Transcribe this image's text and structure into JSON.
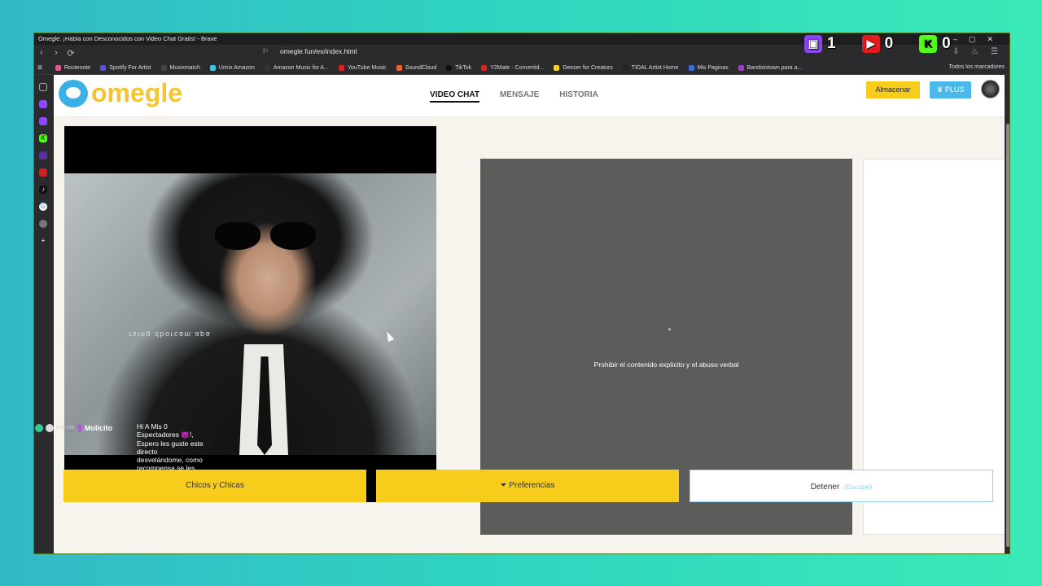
{
  "window": {
    "title": "Omegle: ¡Habla con Desconocidos con Video Chat Gratis! - Brave",
    "url": "omegle.fun/es/index.html"
  },
  "bookmarks": [
    {
      "label": "Routenote",
      "color": "#e05a8c"
    },
    {
      "label": "Spotify For Artist",
      "color": "#5b4fd8"
    },
    {
      "label": "Musixmatch",
      "color": "#444"
    },
    {
      "label": "Urtrix Amazon",
      "color": "#46c4e6"
    },
    {
      "label": "Amazon Music for A...",
      "color": "#333"
    },
    {
      "label": "YouTube Music",
      "color": "#e21f1f"
    },
    {
      "label": "SoundCloud",
      "color": "#ff5a1f"
    },
    {
      "label": "TikTok",
      "color": "#111"
    },
    {
      "label": "Y2Mate - Convertid...",
      "color": "#d22"
    },
    {
      "label": "Deezer for Creators",
      "color": "#f4d329"
    },
    {
      "label": "TIDAL Artist Home",
      "color": "#222"
    },
    {
      "label": "Mis Paginas",
      "color": "#3a6cd8"
    },
    {
      "label": "Bandsintown para a...",
      "color": "#a33ac8"
    }
  ],
  "bookmarks_all": "Todos los marcadores",
  "counters": [
    {
      "icon": "twitch-icon",
      "value": "1",
      "color": "#8a43f2"
    },
    {
      "icon": "youtube-icon",
      "value": "0",
      "color": "#e41b1b"
    },
    {
      "icon": "kick-icon",
      "value": "0",
      "color": "#53fc18"
    }
  ],
  "site": {
    "logo_text": "omegle",
    "menu": [
      "VIDEO CHAT",
      "MENSAJE",
      "HISTORIA"
    ],
    "store_label": "Almacenar",
    "plus_label": "♛ PLUS"
  },
  "stranger_panel": {
    "notice": "Prohibir el contenido explícito y el abuso verbal"
  },
  "self_video": {
    "mirrored_text": "ɐdɐ ɯɐɔɹoqp ɓuısɹ",
    "chat_user": "Molicito",
    "chat_time": "8:56 AM",
    "chat_message": "Hi A Mis 0 Espectadores 😈!, Espero les guste este directo desvelándome, como recompensa se les dará un adelanto de la canción del próximo mes 😊."
  },
  "bottom_buttons": {
    "gender": "Chicos y Chicas",
    "preferences": "Preferencias",
    "stop": "Detener",
    "stop_hint": "(Escape)"
  }
}
